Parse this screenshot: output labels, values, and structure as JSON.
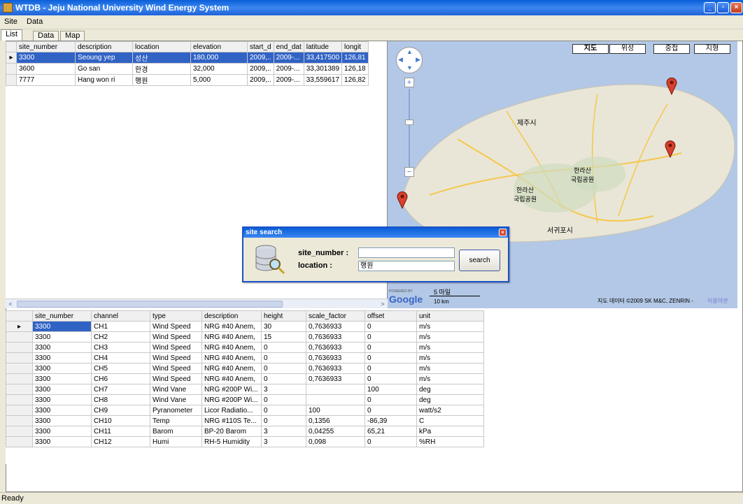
{
  "window": {
    "title": "WTDB - Jeju National University Wind Energy System",
    "min": "_",
    "max": "▫",
    "close": "×"
  },
  "menu": [
    {
      "label": "Site"
    },
    {
      "label": "Data"
    }
  ],
  "tabs": [
    {
      "label": "List"
    },
    {
      "label": "Data"
    },
    {
      "label": "Map"
    }
  ],
  "site_table": {
    "columns": [
      "site_number",
      "description",
      "location",
      "elevation",
      "start_d",
      "end_dat",
      "latitude",
      "longit"
    ],
    "rows": [
      [
        "3300",
        "Seoung yep",
        "성산",
        "180,000",
        "2009,..",
        "2009-...",
        "33,417500",
        "126,81"
      ],
      [
        "3600",
        "Go san",
        "한경",
        "32,000",
        "2009,..",
        "2009-...",
        "33,301389",
        "126,18"
      ],
      [
        "7777",
        "Hang won ri",
        "행원",
        "5,000",
        "2009,..",
        "2009-...",
        "33,559617",
        "126,82"
      ]
    ]
  },
  "scroll": {
    "left": "<",
    "right": ">"
  },
  "map": {
    "types": [
      "지도",
      "위성",
      "중첩",
      "지형"
    ],
    "labels": {
      "jeju": "제주시",
      "hallasan1": "한라산\n국립공원",
      "hallasan2": "한라산\n국립공원",
      "seogwipo": "서귀포시"
    },
    "scale_mi": "5 마일",
    "scale_km": "10 km",
    "powered_by": "POWERED BY",
    "google": "Google",
    "attribution": "지도 데이터 ©2009 SK M&C, ZENRIN - ",
    "terms": "이용약관"
  },
  "channel_table": {
    "columns": [
      "site_number",
      "channel",
      "type",
      "description",
      "height",
      "scale_factor",
      "offset",
      "unit"
    ],
    "rows": [
      [
        "3300",
        "CH1",
        "Wind Speed",
        "NRG #40 Anem,",
        "30",
        "0,7636933",
        "0",
        "m/s"
      ],
      [
        "3300",
        "CH2",
        "Wind Speed",
        "NRG #40 Anem,",
        "15",
        "0,7636933",
        "0",
        "m/s"
      ],
      [
        "3300",
        "CH3",
        "Wind Speed",
        "NRG #40 Anem,",
        "0",
        "0,7636933",
        "0",
        "m/s"
      ],
      [
        "3300",
        "CH4",
        "Wind Speed",
        "NRG #40 Anem,",
        "0",
        "0,7636933",
        "0",
        "m/s"
      ],
      [
        "3300",
        "CH5",
        "Wind Speed",
        "NRG #40 Anem,",
        "0",
        "0,7636933",
        "0",
        "m/s"
      ],
      [
        "3300",
        "CH6",
        "Wind Speed",
        "NRG #40 Anem,",
        "0",
        "0,7636933",
        "0",
        "m/s"
      ],
      [
        "3300",
        "CH7",
        "Wind Vane",
        "NRG #200P Wi...",
        "3",
        "",
        "100",
        "deg"
      ],
      [
        "3300",
        "CH8",
        "Wind Vane",
        "NRG #200P Wi...",
        "0",
        "",
        "0",
        "deg"
      ],
      [
        "3300",
        "CH9",
        "Pyranometer",
        "Licor Radiatio...",
        "0",
        "100",
        "0",
        "watt/s2"
      ],
      [
        "3300",
        "CH10",
        "Temp",
        "NRG #110S Te...",
        "0",
        "0,1356",
        "-86,39",
        "C"
      ],
      [
        "3300",
        "CH11",
        "Barom",
        "BP-20 Barom",
        "3",
        "0,04255",
        "65,21",
        "kPa"
      ],
      [
        "3300",
        "CH12",
        "Humi",
        "RH-5 Humidity",
        "3",
        "0,098",
        "0",
        "%RH"
      ]
    ]
  },
  "dialog": {
    "title": "site search",
    "site_number_label": "site_number :",
    "location_label": "location :",
    "site_number_value": "",
    "location_value": "행원",
    "search_label": "search",
    "close": "×"
  },
  "status": {
    "text": "Ready"
  },
  "colors": {
    "selection": "#3163c5",
    "titlebar": "#0a5fd8"
  }
}
